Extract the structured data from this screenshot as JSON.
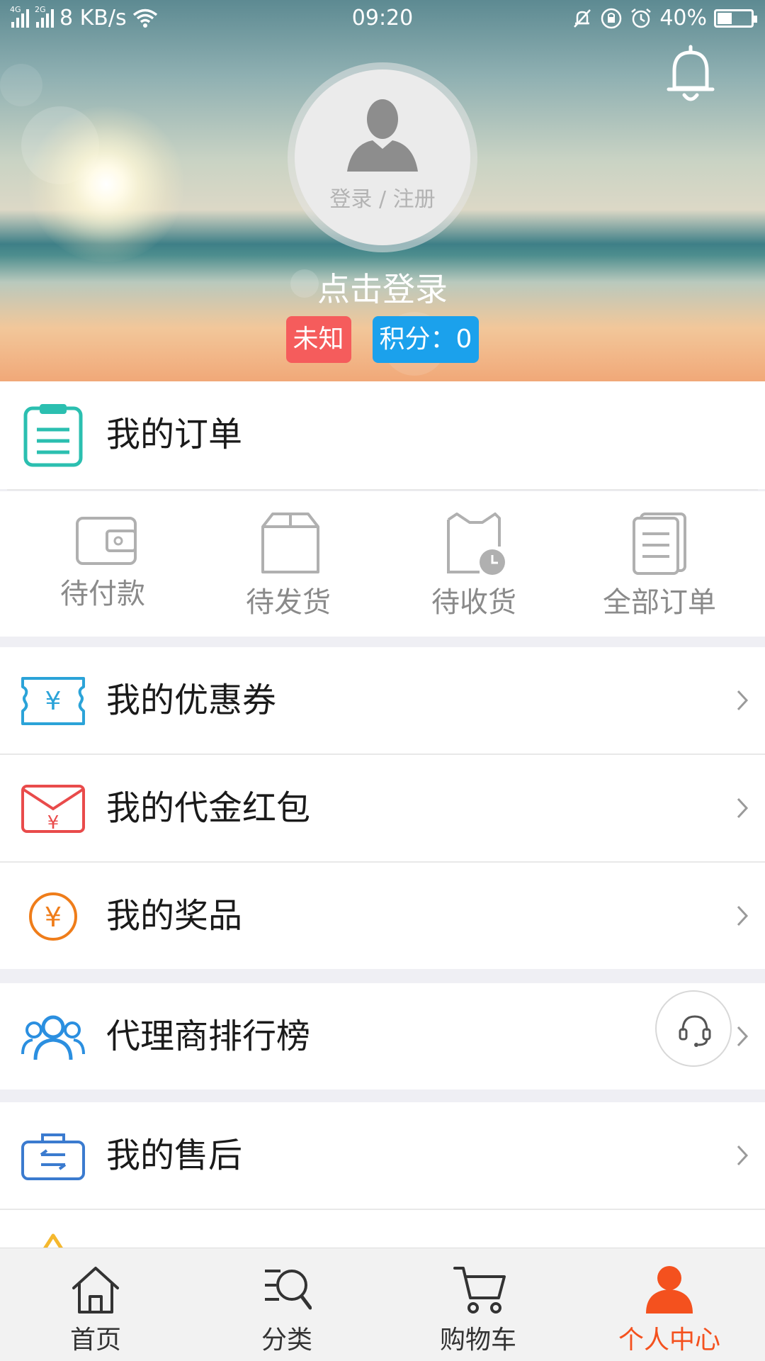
{
  "status_bar": {
    "network_type_1": "4G",
    "network_type_2": "2G",
    "speed": "8 KB/s",
    "time": "09:20",
    "battery": "40%",
    "battery_level": 0.4
  },
  "profile": {
    "avatar_text": "登录 / 注册",
    "login_prompt": "点击登录",
    "badge_unknown": "未知",
    "badge_points": "积分：0"
  },
  "orders": {
    "title": "我的订单",
    "statuses": [
      {
        "label": "待付款",
        "icon": "wallet-icon"
      },
      {
        "label": "待发货",
        "icon": "box-icon"
      },
      {
        "label": "待收货",
        "icon": "delivery-clock-icon"
      },
      {
        "label": "全部订单",
        "icon": "documents-icon"
      }
    ]
  },
  "menu": [
    {
      "label": "我的优惠券",
      "icon": "coupon-icon"
    },
    {
      "label": "我的代金红包",
      "icon": "red-envelope-icon"
    },
    {
      "label": "我的奖品",
      "icon": "yen-coin-icon"
    },
    {
      "label": "代理商排行榜",
      "icon": "users-icon"
    },
    {
      "label": "我的售后",
      "icon": "after-sales-icon"
    }
  ],
  "tabs": [
    {
      "label": "首页",
      "icon": "home-icon"
    },
    {
      "label": "分类",
      "icon": "category-search-icon"
    },
    {
      "label": "购物车",
      "icon": "cart-icon"
    },
    {
      "label": "个人中心",
      "icon": "person-icon"
    }
  ],
  "colors": {
    "accent": "#f4511e",
    "badge_red": "#f55c5c",
    "badge_blue": "#1ba1ec",
    "orders_icon": "#2bbfb0",
    "coupon_icon": "#2ba3d8",
    "envelope_icon": "#e94b4b",
    "prize_icon": "#ef7d1a",
    "users_icon": "#2b8fe0",
    "after_sales_icon": "#3b7bcf"
  }
}
